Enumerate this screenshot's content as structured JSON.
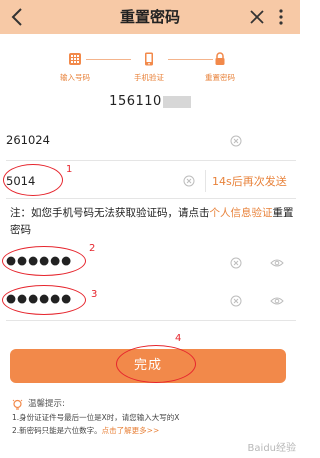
{
  "header": {
    "title": "重置密码"
  },
  "steps": [
    {
      "label": "输入号码"
    },
    {
      "label": "手机验证"
    },
    {
      "label": "重置密码"
    }
  ],
  "phone": {
    "number": "156110"
  },
  "form": {
    "id_value": "261024",
    "code_value": "5014",
    "resend_label": "14s后再次发送",
    "note_text": "注：如您手机号码无法获取验证码，请点击",
    "note_link": "个人信息验证",
    "note_tail": "重置密码",
    "password_mask": "●●●●●●",
    "confirm_mask": "●●●●●●"
  },
  "annotations": [
    "1",
    "2",
    "3",
    "4"
  ],
  "done_label": "完成",
  "tips": {
    "title": "温馨提示:",
    "line1": "1.身份证证件号最后一位是X时，请您输入大写的X",
    "line2_text": "2.新密码只能是六位数字。",
    "line2_link": "点击了解更多>>"
  },
  "watermark": "Baidu经验",
  "colors": {
    "accent": "#e8823a",
    "header_bg": "#f7c9a6",
    "button": "#f2894a",
    "annotation_red": "#e6262e"
  }
}
